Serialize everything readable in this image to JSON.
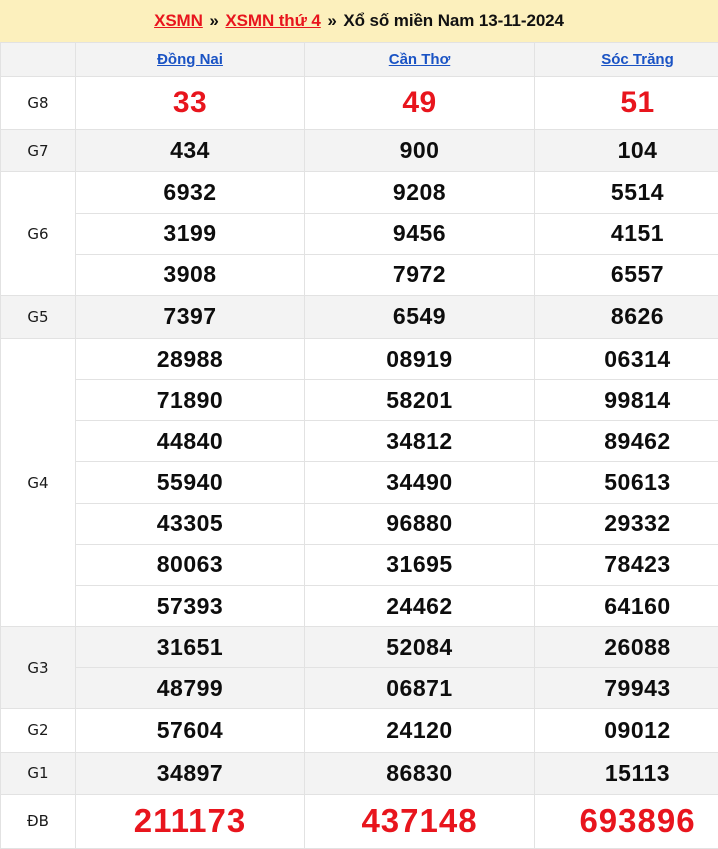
{
  "banner": {
    "link1": "XSMN",
    "sep1": "»",
    "link2": "XSMN thứ 4",
    "sep2": "»",
    "title": "Xổ số miền Nam 13-11-2024"
  },
  "table": {
    "corner_label": "",
    "columns": [
      "Đồng Nai",
      "Cần Thơ",
      "Sóc Trăng"
    ],
    "colors": {
      "banner_bg": "#fcf0bd",
      "link_red": "#e8151d",
      "province_link_blue": "#1a53c4",
      "stripe_bg": "#f3f3f3",
      "border": "#e2e2e2",
      "number_black": "#0d0d0d"
    },
    "prizes": [
      {
        "label": "G8",
        "rows": [
          [
            "33",
            "49",
            "51"
          ]
        ]
      },
      {
        "label": "G7",
        "rows": [
          [
            "434",
            "900",
            "104"
          ]
        ]
      },
      {
        "label": "G6",
        "rows": [
          [
            "6932",
            "9208",
            "5514"
          ],
          [
            "3199",
            "9456",
            "4151"
          ],
          [
            "3908",
            "7972",
            "6557"
          ]
        ]
      },
      {
        "label": "G5",
        "rows": [
          [
            "7397",
            "6549",
            "8626"
          ]
        ]
      },
      {
        "label": "G4",
        "rows": [
          [
            "28988",
            "08919",
            "06314"
          ],
          [
            "71890",
            "58201",
            "99814"
          ],
          [
            "44840",
            "34812",
            "89462"
          ],
          [
            "55940",
            "34490",
            "50613"
          ],
          [
            "43305",
            "96880",
            "29332"
          ],
          [
            "80063",
            "31695",
            "78423"
          ],
          [
            "57393",
            "24462",
            "64160"
          ]
        ]
      },
      {
        "label": "G3",
        "rows": [
          [
            "31651",
            "52084",
            "26088"
          ],
          [
            "48799",
            "06871",
            "79943"
          ]
        ]
      },
      {
        "label": "G2",
        "rows": [
          [
            "57604",
            "24120",
            "09012"
          ]
        ]
      },
      {
        "label": "G1",
        "rows": [
          [
            "34897",
            "86830",
            "15113"
          ]
        ]
      },
      {
        "label": "ĐB",
        "rows": [
          [
            "211173",
            "437148",
            "693896"
          ]
        ]
      }
    ]
  }
}
